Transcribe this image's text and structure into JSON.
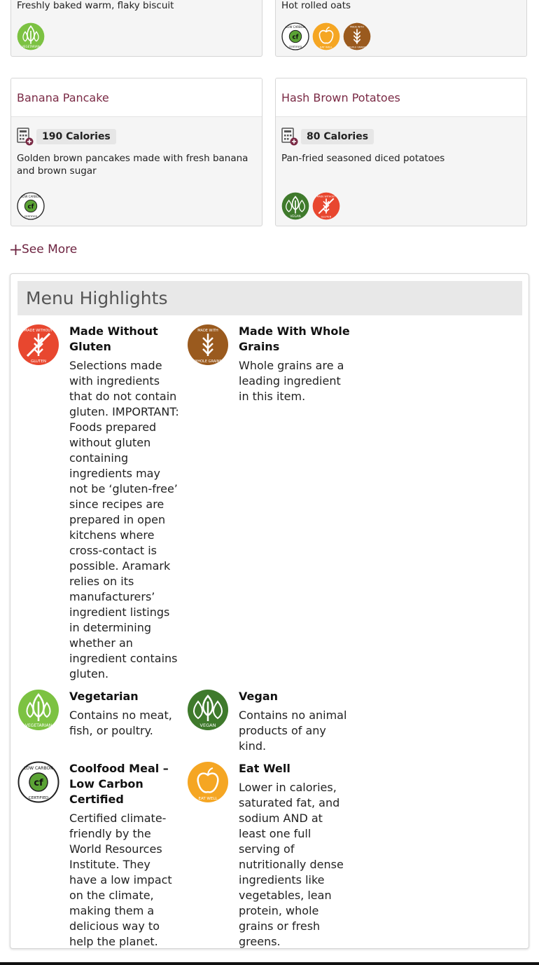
{
  "top_cards": [
    {
      "description": "Freshly baked warm, flaky biscuit",
      "badges": [
        "vegetarian"
      ]
    },
    {
      "description": "Hot rolled oats",
      "badges": [
        "low-carbon",
        "eat-well",
        "whole-grains"
      ]
    }
  ],
  "cards": [
    {
      "title": "Banana Pancake",
      "calories": "190 Calories",
      "description": "Golden brown pancakes made with fresh banana and brown sugar",
      "badges": [
        "low-carbon"
      ]
    },
    {
      "title": "Hash Brown Potatoes",
      "calories": "80 Calories",
      "description": "Pan-fried seasoned diced potatoes",
      "badges": [
        "vegan",
        "without-gluten"
      ]
    }
  ],
  "see_more": "See More",
  "highlights": {
    "title": "Menu Highlights",
    "items": [
      {
        "key": "without-gluten",
        "name": "Made Without Gluten",
        "text": "Selections made with ingredients that do not contain gluten. IMPORTANT: Foods prepared without gluten containing ingredients may not be ‘gluten-free’ since recipes are prepared in open kitchens where cross-contact is possible. Aramark relies on its manufacturers’ ingredient listings in determining whether an ingredient contains gluten."
      },
      {
        "key": "whole-grains",
        "name": "Made With Whole Grains",
        "text": "Whole grains are a leading ingredient in this item."
      },
      {
        "key": "vegetarian",
        "name": "Vegetarian",
        "text": "Contains no meat, fish, or poultry."
      },
      {
        "key": "vegan",
        "name": "Vegan",
        "text": "Contains no animal products of any kind."
      },
      {
        "key": "low-carbon",
        "name": "Coolfood Meal – Low Carbon Certified",
        "text": "Certified climate-friendly by the World Resources Institute. They have a low impact on the climate, making them a delicious way to help the planet."
      },
      {
        "key": "eat-well",
        "name": "Eat Well",
        "text": "Lower in calories, saturated fat, and sodium AND at least one full serving of nutritionally dense ingredients like vegetables, lean protein, whole grains or fresh greens."
      }
    ]
  },
  "colors": {
    "title": "#7a2a45",
    "vegetarian": "#7cc242",
    "vegan": "#3f7a2c",
    "without_gluten": "#e8472f",
    "whole_grains": "#9a5a1e",
    "eat_well": "#f5a623"
  }
}
